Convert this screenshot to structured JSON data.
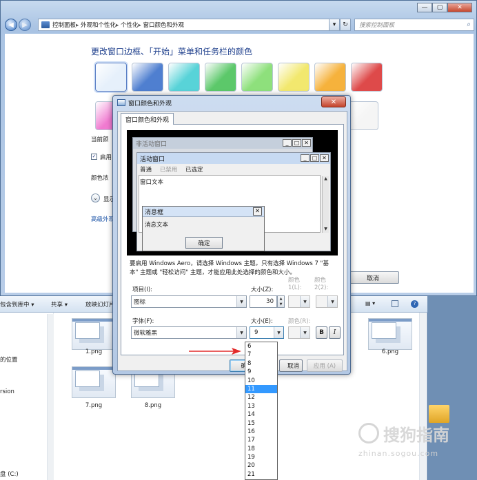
{
  "control_panel": {
    "breadcrumbs": [
      "控制面板",
      "外观和个性化",
      "个性化",
      "窗口颜色和外观"
    ],
    "search_placeholder": "搜索控制面板",
    "heading": "更改窗口边框、「开始」菜单和任务栏的颜色",
    "swatch_colors_row1": [
      "#e6f0fb",
      "#4f7fd0",
      "#58d3d8",
      "#5cc86a",
      "#8ee07c",
      "#f2e86e",
      "#f6b23c",
      "#de4a4a"
    ],
    "swatch_colors_row2": [
      "#f07ad0",
      "#f5f5f5"
    ],
    "current_color_label": "当前颜",
    "enable_label": "启用",
    "intensity_label": "颜色浓",
    "show_label": "显示",
    "advanced_link": "高级外观",
    "cancel_label": "取消"
  },
  "explorer": {
    "toolbar_items": [
      "包含到库中 ▾",
      "共享 ▾",
      "放映幻灯片"
    ],
    "nav_items": [
      "的位置",
      "rsion",
      "盘 (C:)"
    ],
    "thumbnails": [
      {
        "label": "1.png"
      },
      {
        "label": "6.png"
      },
      {
        "label": "7.png"
      },
      {
        "label": "8.png"
      }
    ]
  },
  "dialog": {
    "title": "窗口颜色和外观",
    "tab": "窗口颜色和外观",
    "preview": {
      "inactive_title": "非活动窗口",
      "active_title": "活动窗口",
      "menu_normal": "普通",
      "menu_disabled": "已禁用",
      "menu_selected": "已选定",
      "window_text": "窗口文本",
      "msgbox_title": "消息框",
      "msgbox_text": "消息文本",
      "ok_label": "确定"
    },
    "description": "要启用 Windows Aero，请选择 Windows 主题。只有选择 Windows 7 \"基本\" 主题或 \"轻松访问\" 主题，才能应用此处选择的颜色和大小。",
    "item_label": "项目(I):",
    "item_value": "图标",
    "size_label": "大小(Z):",
    "size_value": "30",
    "color1_label": "颜色 1(L):",
    "color2_label": "颜色 2(2):",
    "font_label": "字体(F):",
    "font_value": "微软雅黑",
    "font_size_label": "大小(E):",
    "font_size_value": "9",
    "font_color_label": "颜色(R):",
    "bold_label": "B",
    "italic_label": "I",
    "ok_partial": "确",
    "cancel_partial": "取消",
    "apply_label": "应用 (A)"
  },
  "font_size_options": [
    "6",
    "7",
    "8",
    "9",
    "10",
    "11",
    "12",
    "13",
    "14",
    "15",
    "16",
    "17",
    "18",
    "19",
    "20",
    "21"
  ],
  "font_size_highlighted": "11",
  "watermark": {
    "text": "搜狗指南",
    "domain": "zhinan.sogou.com"
  }
}
